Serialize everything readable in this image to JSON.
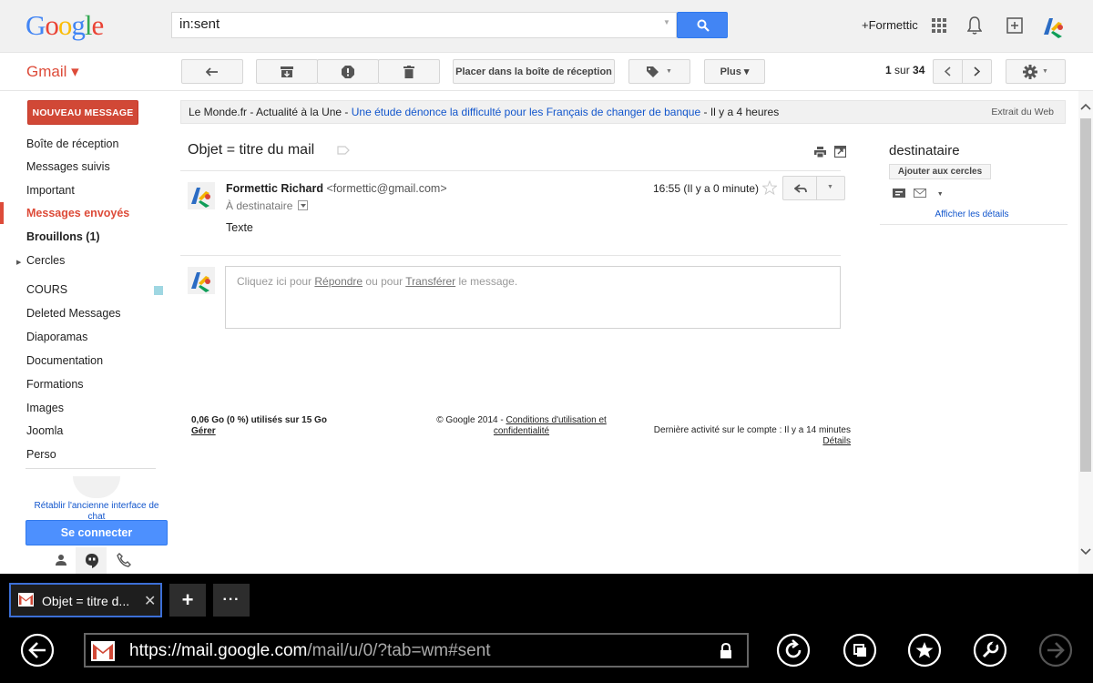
{
  "header": {
    "logo": "Google",
    "search_value": "in:sent",
    "plus_name": "+Formettic"
  },
  "toolbar": {
    "app_label": "Gmail ▾",
    "move_inbox": "Placer dans la boîte de réception",
    "more": "Plus ▾",
    "pager_range": "1",
    "pager_sep": "sur",
    "pager_total": "34"
  },
  "sidebar": {
    "compose": "NOUVEAU MESSAGE",
    "items": [
      {
        "label": "Boîte de réception"
      },
      {
        "label": "Messages suivis"
      },
      {
        "label": "Important"
      },
      {
        "label": "Messages envoyés"
      },
      {
        "label": "Brouillons (1)"
      },
      {
        "label": "Cercles"
      },
      {
        "label": "COURS"
      },
      {
        "label": "Deleted Messages"
      },
      {
        "label": "Diaporamas"
      },
      {
        "label": "Documentation"
      },
      {
        "label": "Formations"
      },
      {
        "label": "Images"
      },
      {
        "label": "Joomla"
      },
      {
        "label": "Perso"
      }
    ],
    "restore_chat": "Rétablir l'ancienne interface de chat",
    "connect": "Se connecter"
  },
  "webclip": {
    "source": "Le Monde.fr - Actualité à la Une - ",
    "headline": "Une étude dénonce la difficulté pour les Français de changer de banque",
    "age": " - Il y a 4 heures",
    "label": "Extrait du Web"
  },
  "thread": {
    "subject": "Objet = titre du mail",
    "sender_name": "Formettic Richard",
    "sender_email": "<formettic@gmail.com>",
    "to": "À destinataire",
    "time": "16:55 (Il y a 0 minute)",
    "body": "Texte",
    "reply_prefix": "Cliquez ici pour ",
    "reply_link": "Répondre",
    "reply_mid": " ou pour ",
    "forward_link": "Transférer",
    "reply_suffix": " le message."
  },
  "footer": {
    "storage": "0,06 Go (0 %) utilisés sur 15 Go",
    "manage": "Gérer",
    "copyright": "© Google 2014 - ",
    "terms": "Conditions d'utilisation et confidentialité",
    "last_activity": "Dernière activité sur le compte : Il y a 14 minutes",
    "details": "Détails"
  },
  "right_panel": {
    "name": "destinataire",
    "add_circles": "Ajouter aux cercles",
    "show_details": "Afficher les détails"
  },
  "browser": {
    "tab_title": "Objet = titre d...",
    "url_host": "https://mail.google.com",
    "url_path": "/mail/u/0/?tab=wm#sent"
  },
  "colors": {
    "gmail_red": "#dd4b39",
    "compose_red": "#d14836",
    "search_blue": "#4285f4",
    "link_blue": "#1155cc"
  }
}
